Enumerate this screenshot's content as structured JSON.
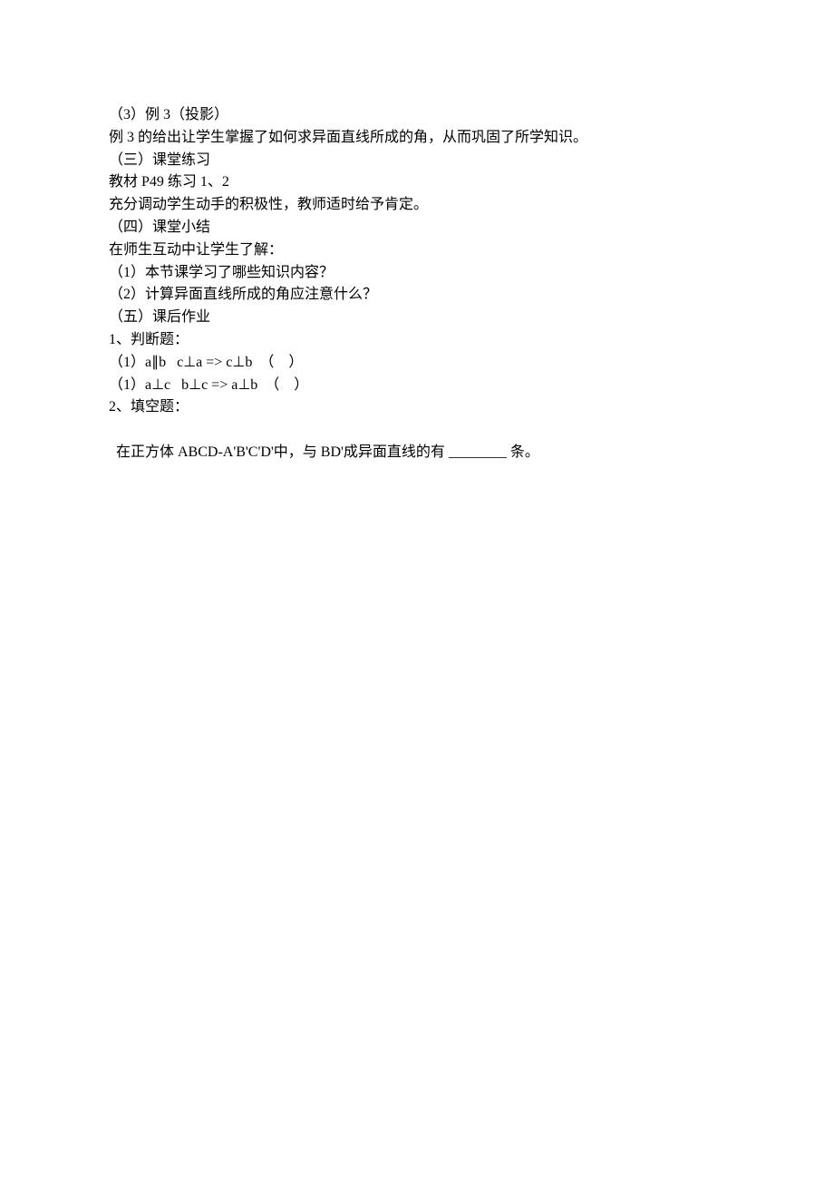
{
  "lines": {
    "l1": "（3）例 3（投影）",
    "l2": "例 3 的给出让学生掌握了如何求异面直线所成的角，从而巩固了所学知识。",
    "l3": "（三）课堂练习",
    "l4": "教材 P49 练习 1、2",
    "l5": "充分调动学生动手的积极性，教师适时给予肯定。",
    "l6": "（四）课堂小结",
    "l7": "在师生互动中让学生了解：",
    "l8": "（1）本节课学习了哪些知识内容？",
    "l9": "（2）计算异面直线所成的角应注意什么？",
    "l10": "（五）课后作业",
    "l11": "1、判断题：",
    "l12": "（1）a∥b   c⊥a => c⊥b  （    ）",
    "l13": "（1）a⊥c   b⊥c => a⊥b  （    ）",
    "l14": "2、填空题：",
    "l15a": "在正方体 ABCD-A'B'C'D'中，与 BD'成异面直线的有 ",
    "l15b": " 条。"
  }
}
